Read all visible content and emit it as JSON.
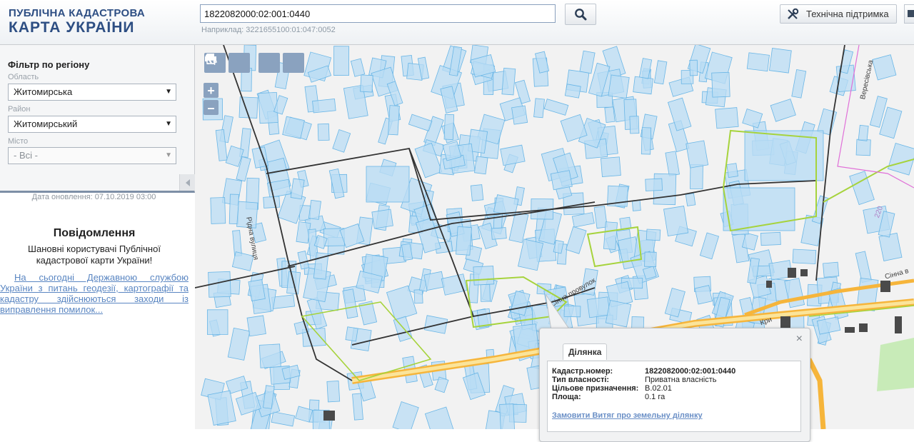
{
  "logo": {
    "line1": "ПУБЛІЧНА КАДАСТРОВА",
    "line2": "КАРТА УКРАЇНИ"
  },
  "search": {
    "value": "1822082000:02:001:0440",
    "hint": "Наприклад: 3221655100:01:047:0052"
  },
  "header": {
    "support_label": "Технічна підтримка"
  },
  "filter": {
    "title": "Фільтр по регіону",
    "region_label": "Область",
    "region_value": "Житомирська",
    "district_label": "Район",
    "district_value": "Житомирський",
    "city_label": "Місто",
    "city_value": "- Всі -"
  },
  "update_date": "Дата оновлення: 07.10.2019 03:00",
  "notice": {
    "title": "Повідомлення",
    "body": "Шановні користувачі Публічної кадастрової карти України!",
    "link": "На сьогодні Державною службою України з питань геодезії, картографії та кадастру здійснюються заходи із виправлення помилок..."
  },
  "map": {
    "streets": {
      "ridna": "Рідна вулиця",
      "sinna_lane": "Сінна провулок",
      "sinna": "Сінна вулиця",
      "veresivska": "Вересівська",
      "sinna_right": "Сінна в",
      "kri": "Кри",
      "num_220": "220"
    },
    "colors": {
      "parcel_fill": "#b9dcf4",
      "parcel_stroke": "#6ab6e6",
      "boundary_green": "#a6d33c",
      "road_orange": "#f6b53b",
      "road_yellow": "#fbe49a",
      "block_line": "#333333"
    }
  },
  "popup": {
    "tab": "Ділянка",
    "close": "×",
    "rows": [
      {
        "key": "Кадастр.номер:",
        "value": "1822082000:02:001:0440"
      },
      {
        "key": "Тип власності:",
        "value": "Приватна власність"
      },
      {
        "key": "Цільове призначення:",
        "value": "В.02.01"
      },
      {
        "key": "Площа:",
        "value": "0.1 га"
      }
    ],
    "link": "Замовити Витяг про земельну ділянку"
  }
}
